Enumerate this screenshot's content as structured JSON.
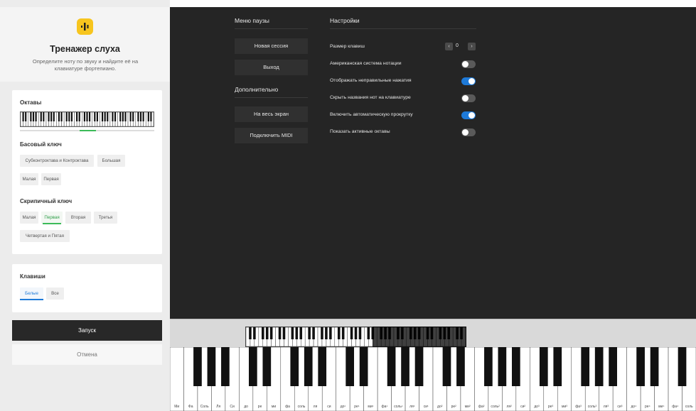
{
  "header": {
    "title": "Тренажер слуха",
    "description": "Определите ноту по звуку и найдите её на клавиатуре фортепиано."
  },
  "octaves": {
    "label": "Октавы",
    "bass": {
      "label": "Басовый ключ",
      "chips": [
        "Субконтроктава и Контроктава",
        "Большая",
        "Малая",
        "Первая"
      ]
    },
    "treble": {
      "label": "Скрипичный ключ",
      "chips": [
        "Малая",
        "Первая",
        "Вторая",
        "Третья",
        "Четвертая и Пятая"
      ],
      "active": "Первая"
    }
  },
  "keys": {
    "label": "Клавиши",
    "chips": [
      "Белые",
      "Все"
    ],
    "active": "Белые"
  },
  "buttons": {
    "start": "Запуск",
    "cancel": "Отмена"
  },
  "pause_menu": {
    "title": "Меню паузы",
    "new_session": "Новая сессия",
    "exit": "Выход",
    "extra_title": "Дополнительно",
    "fullscreen": "На весь экран",
    "midi": "Подключить MIDI"
  },
  "settings": {
    "title": "Настройки",
    "key_size_label": "Размер клавиш",
    "key_size_value": "0",
    "items": [
      {
        "label": "Американская система нотации",
        "on": false
      },
      {
        "label": "Отображать неправильные нажатия",
        "on": true
      },
      {
        "label": "Скрыть названия нот на клавиатуре",
        "on": false
      },
      {
        "label": "Включить автоматическую прокрутку",
        "on": true
      },
      {
        "label": "Показать активные октавы",
        "on": false
      }
    ]
  },
  "keyboard": {
    "note_labels": [
      "Ми",
      "Фа",
      "Соль",
      "Ля",
      "Си",
      "до",
      "ре",
      "ми",
      "фа",
      "соль",
      "ля",
      "си",
      "до¹",
      "ре¹",
      "ми¹",
      "фа¹",
      "соль¹",
      "ля¹",
      "си¹",
      "до²",
      "ре²",
      "ми²",
      "фа²",
      "соль²",
      "ля²",
      "си²",
      "до³",
      "ре³",
      "ми³",
      "фа³",
      "соль³",
      "ля³",
      "си³",
      "до⁴",
      "ре⁴",
      "ми⁴",
      "фа⁴",
      "соль"
    ]
  },
  "colors": {
    "accent_yellow": "#f7c51e",
    "accent_green": "#3cbb59",
    "accent_blue": "#1e7ad8",
    "dark_bg": "#252525"
  }
}
